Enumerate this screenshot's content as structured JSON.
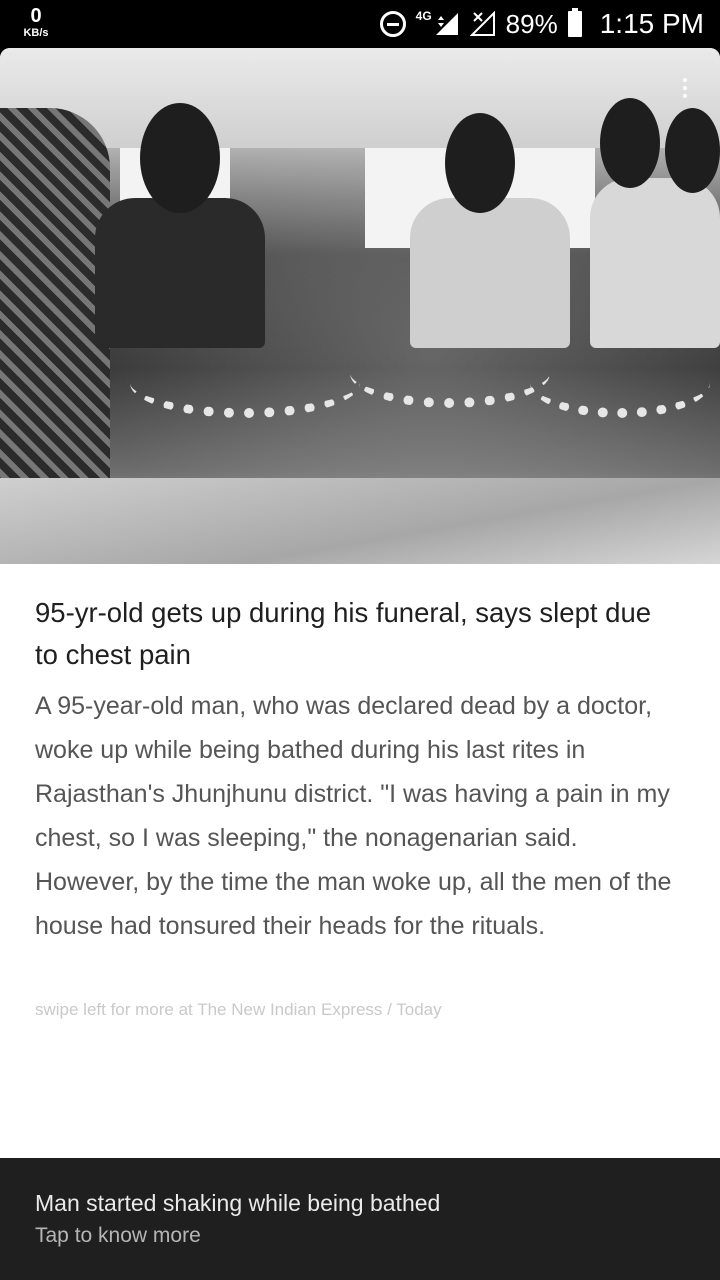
{
  "status_bar": {
    "net_speed_value": "0",
    "net_speed_unit": "KB/s",
    "network_type": "4G",
    "battery": "89%",
    "time": "1:15 PM",
    "icons": [
      "do-not-disturb-icon",
      "signal-icon",
      "no-sim-icon",
      "battery-icon"
    ]
  },
  "article": {
    "headline": "95-yr-old gets up during his funeral, says slept due to chest pain",
    "body": "A 95-year-old man, who was declared dead by a doctor, woke up while being bathed during his last rites in Rajasthan's Jhunjhunu district. \"I was having a pain in my chest, so I was sleeping,\" the nonagenarian said. However, by the time the man woke up, all the men of the house had tonsured their heads for the rituals.",
    "source_line": "swipe left for more at The New Indian Express / Today"
  },
  "footer": {
    "tagline": "Man started shaking while being bathed",
    "cta": "Tap to know more"
  }
}
